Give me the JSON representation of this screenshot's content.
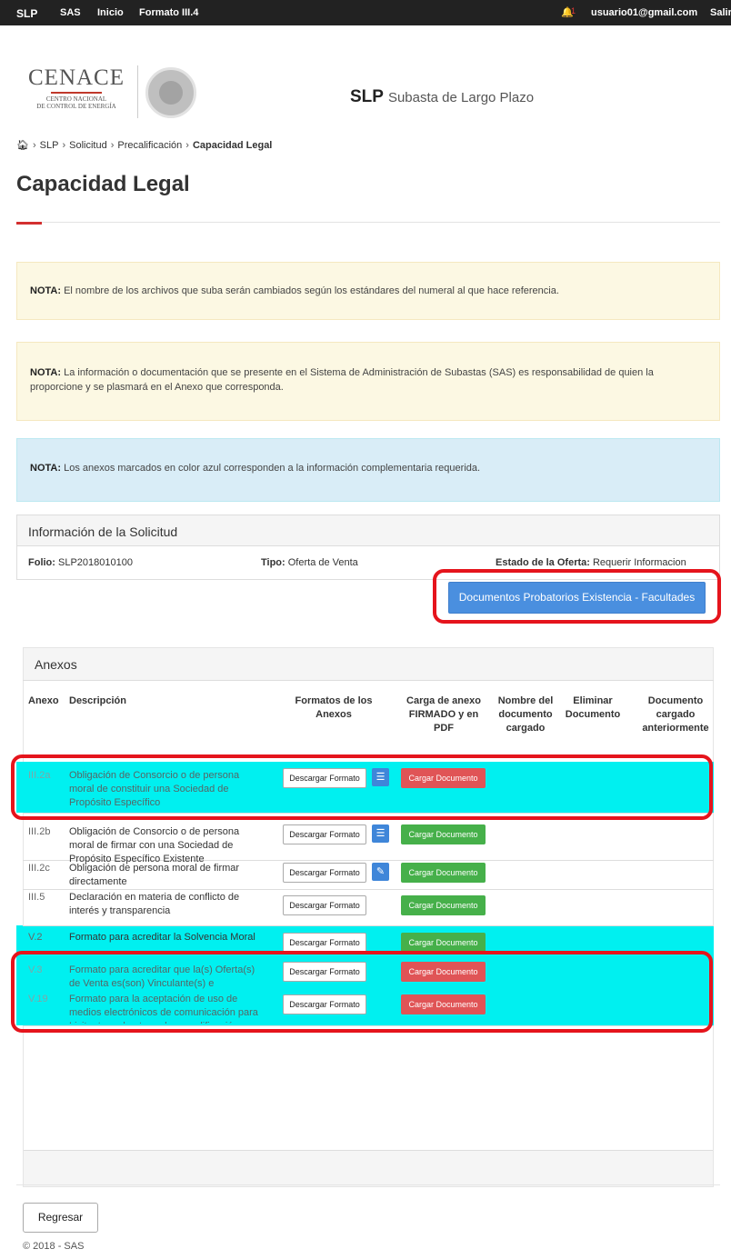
{
  "navbar": {
    "brand": "SLP",
    "items": [
      "SAS",
      "Inicio",
      "Formato III.4"
    ],
    "badge": "1",
    "user_email": "usuario01@gmail.com",
    "logout": "Salir",
    "bg": "#222222"
  },
  "header": {
    "logo_main": "CENACE",
    "logo_sub_1": "CENTRO NACIONAL",
    "logo_sub_2": "DE CONTROL DE ENERGÍA",
    "app_code": "SLP",
    "app_name": "Subasta de Largo Plazo"
  },
  "breadcrumb": [
    "SLP",
    "Solicitud",
    "Precalificación",
    "Capacidad Legal"
  ],
  "page_title": "Capacidad Legal",
  "notes": [
    {
      "label": "NOTA:",
      "text": "El nombre de los archivos que suba serán cambiados según los estándares del numeral al que hace referencia.",
      "type": "warning"
    },
    {
      "label": "NOTA:",
      "text": "La información o documentación que se presente en el Sistema de Administración de Subastas (SAS) es responsabilidad de quien la proporcione y se plasmará en el Anexo que corresponda.",
      "type": "warning"
    },
    {
      "label": "NOTA:",
      "text": "Los anexos marcados en color azul corresponden a la información complementaria requerida.",
      "type": "info"
    }
  ],
  "solicitud": {
    "heading": "Información de la Solicitud",
    "folio_label": "Folio:",
    "folio": "SLP2018010100",
    "tipo_label": "Tipo:",
    "tipo": "Oferta de Venta",
    "estado_label": "Estado de la Oferta:",
    "estado": "Requerir Informacion"
  },
  "primary_button": "Documentos Probatorios Existencia - Facultades",
  "anexos": {
    "heading": "Anexos",
    "columns": [
      "Anexo",
      "Descripción",
      "Formatos de los Anexos",
      "Carga de anexo FIRMADO y en PDF",
      "Nombre del documento cargado",
      "Eliminar Documento",
      "Documento cargado anteriormente"
    ],
    "download_label": "Descargar Formato",
    "upload_label": "Cargar Documento",
    "rows": [
      {
        "anexo": "III.2a",
        "descripcion": "Obligación de Consorcio o de persona moral de constituir una Sociedad de Propósito Específico",
        "icon": "list-icon",
        "upload_status": "red",
        "highlight": true
      },
      {
        "anexo": "III.2b",
        "descripcion": "Obligación de Consorcio o de persona moral de firmar con una Sociedad de Propósito Específico Existente",
        "icon": "list-icon",
        "upload_status": "green",
        "highlight": false
      },
      {
        "anexo": "III.2c",
        "descripcion": "Obligación de persona moral de firmar directamente",
        "icon": "pencil-icon",
        "upload_status": "green",
        "highlight": false
      },
      {
        "anexo": "III.5",
        "descripcion": "Declaración en materia de conflicto de interés y transparencia",
        "icon": "",
        "upload_status": "green",
        "highlight": false
      },
      {
        "anexo": "V.2",
        "descripcion": "Formato para acreditar la Solvencia Moral",
        "icon": "",
        "upload_status": "green",
        "highlight": false
      },
      {
        "anexo": "V.3",
        "descripcion": "Formato para acreditar que la(s) Oferta(s) de Venta es(son) Vinculante(s) e Irrevocable(s)",
        "icon": "",
        "upload_status": "red",
        "highlight": true
      },
      {
        "anexo": "V.19",
        "descripcion": "Formato para la aceptación de uso de medios electrónicos de comunicación para Licitante en la etapa de precalificación",
        "icon": "",
        "upload_status": "red",
        "highlight": true
      }
    ]
  },
  "back_button": "Regresar",
  "footer": "© 2018 - SAS",
  "colors": {
    "highlight": "#00f0f0",
    "outline": "#e5141c",
    "primary": "#4a8fdf",
    "danger": "#e05456",
    "success": "#46b04a"
  }
}
